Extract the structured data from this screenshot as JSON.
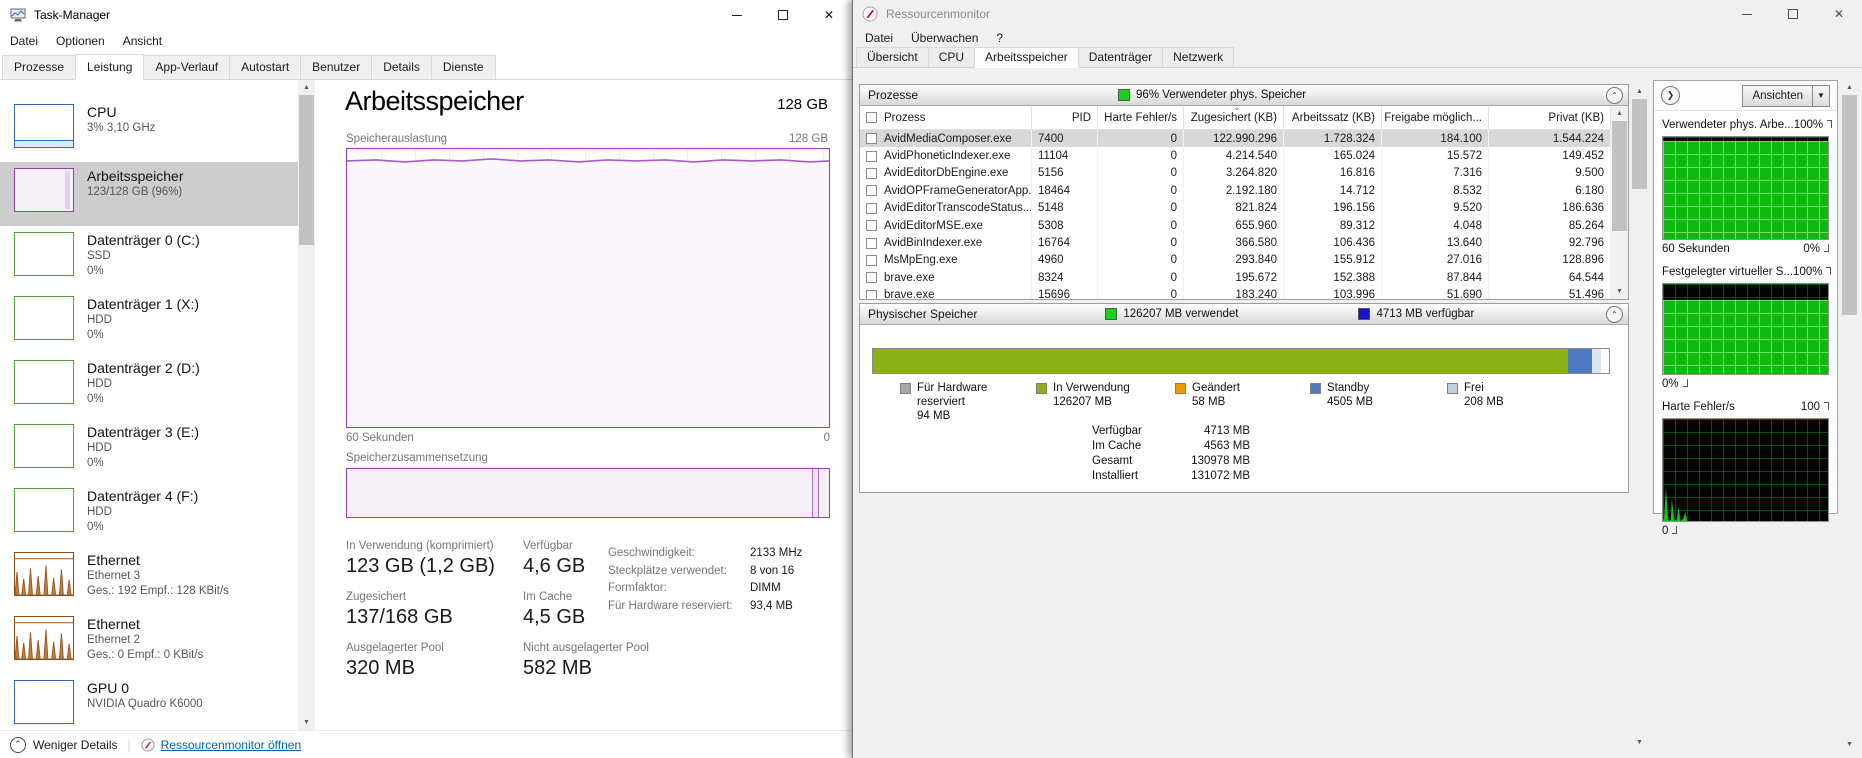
{
  "taskmanager": {
    "title": "Task-Manager",
    "menu": [
      {
        "label": "Datei"
      },
      {
        "label": "Optionen"
      },
      {
        "label": "Ansicht"
      }
    ],
    "tabs": [
      {
        "label": "Prozesse"
      },
      {
        "label": "Leistung",
        "active": true
      },
      {
        "label": "App-Verlauf"
      },
      {
        "label": "Autostart"
      },
      {
        "label": "Benutzer"
      },
      {
        "label": "Details"
      },
      {
        "label": "Dienste"
      }
    ],
    "sidebar": [
      {
        "name": "CPU",
        "line1": "3%  3,10 GHz",
        "type": "cpu"
      },
      {
        "name": "Arbeitsspeicher",
        "line1": "123/128 GB (96%)",
        "type": "memory",
        "selected": true
      },
      {
        "name": "Datenträger 0 (C:)",
        "line1": "SSD",
        "line2": "0%",
        "type": "disk"
      },
      {
        "name": "Datenträger 1 (X:)",
        "line1": "HDD",
        "line2": "0%",
        "type": "disk"
      },
      {
        "name": "Datenträger 2 (D:)",
        "line1": "HDD",
        "line2": "0%",
        "type": "disk"
      },
      {
        "name": "Datenträger 3 (E:)",
        "line1": "HDD",
        "line2": "0%",
        "type": "disk"
      },
      {
        "name": "Datenträger 4 (F:)",
        "line1": "HDD",
        "line2": "0%",
        "type": "disk"
      },
      {
        "name": "Ethernet",
        "line1": "Ethernet 3",
        "line2": "Ges.: 192 Empf.: 128 KBit/s",
        "type": "net"
      },
      {
        "name": "Ethernet",
        "line1": "Ethernet 2",
        "line2": "Ges.: 0 Empf.: 0 KBit/s",
        "type": "net"
      },
      {
        "name": "GPU 0",
        "line1": "NVIDIA Quadro K6000",
        "type": "gpu"
      }
    ],
    "main": {
      "title": "Arbeitsspeicher",
      "capacity": "128 GB",
      "usage_label": "Speicherauslastung",
      "usage_max": "128 GB",
      "time_label": "60 Sekunden",
      "time_right": "0",
      "comp_label": "Speicherzusammensetzung",
      "stats_col1": [
        {
          "label": "In Verwendung (komprimiert)",
          "value": "123 GB (1,2 GB)"
        },
        {
          "label": "Zugesichert",
          "value": "137/168 GB"
        },
        {
          "label": "Ausgelagerter Pool",
          "value": "320 MB"
        }
      ],
      "stats_col2": [
        {
          "label": "Verfügbar",
          "value": "4,6 GB"
        },
        {
          "label": "Im Cache",
          "value": "4,5 GB"
        },
        {
          "label": "Nicht ausgelagerter Pool",
          "value": "582 MB"
        }
      ],
      "details": [
        {
          "label": "Geschwindigkeit:",
          "value": "2133 MHz"
        },
        {
          "label": "Steckplätze verwendet:",
          "value": "8 von 16"
        },
        {
          "label": "Formfaktor:",
          "value": "DIMM"
        },
        {
          "label": "Für Hardware reserviert:",
          "value": "93,4 MB"
        }
      ]
    },
    "footer": {
      "toggle": "Weniger Details",
      "link": "Ressourcenmonitor öffnen"
    }
  },
  "resmon": {
    "title": "Ressourcenmonitor",
    "menu": [
      {
        "label": "Datei"
      },
      {
        "label": "Überwachen"
      },
      {
        "label": "?"
      }
    ],
    "tabs": [
      {
        "label": "Übersicht"
      },
      {
        "label": "CPU"
      },
      {
        "label": "Arbeitsspeicher",
        "active": true
      },
      {
        "label": "Datenträger"
      },
      {
        "label": "Netzwerk"
      }
    ],
    "processes": {
      "title": "Prozesse",
      "status": "96% Verwendeter phys. Speicher",
      "status_color": "#17d417",
      "columns": [
        {
          "label": "Prozess"
        },
        {
          "label": "PID"
        },
        {
          "label": "Harte Fehler/s"
        },
        {
          "label": "Zugesichert (KB)",
          "sort": true
        },
        {
          "label": "Arbeitssatz (KB)"
        },
        {
          "label": "Freigabe möglich..."
        },
        {
          "label": "Privat (KB)"
        }
      ],
      "rows": [
        {
          "name": "AvidMediaComposer.exe",
          "pid": "7400",
          "hf": "0",
          "zug": "122.990.296",
          "arb": "1.728.324",
          "frei": "184.100",
          "priv": "1.544.224",
          "selected": true
        },
        {
          "name": "AvidPhoneticIndexer.exe",
          "pid": "11104",
          "hf": "0",
          "zug": "4.214.540",
          "arb": "165.024",
          "frei": "15.572",
          "priv": "149.452"
        },
        {
          "name": "AvidEditorDbEngine.exe",
          "pid": "5156",
          "hf": "0",
          "zug": "3.264.820",
          "arb": "16.816",
          "frei": "7.316",
          "priv": "9.500"
        },
        {
          "name": "AvidOPFrameGeneratorApp...",
          "pid": "18464",
          "hf": "0",
          "zug": "2.192.180",
          "arb": "14.712",
          "frei": "8.532",
          "priv": "6.180"
        },
        {
          "name": "AvidEditorTranscodeStatus...",
          "pid": "5148",
          "hf": "0",
          "zug": "821.824",
          "arb": "196.156",
          "frei": "9.520",
          "priv": "186.636"
        },
        {
          "name": "AvidEditorMSE.exe",
          "pid": "5308",
          "hf": "0",
          "zug": "655.960",
          "arb": "89.312",
          "frei": "4.048",
          "priv": "85.264"
        },
        {
          "name": "AvidBinIndexer.exe",
          "pid": "16764",
          "hf": "0",
          "zug": "366.580",
          "arb": "106.436",
          "frei": "13.640",
          "priv": "92.796"
        },
        {
          "name": "MsMpEng.exe",
          "pid": "4960",
          "hf": "0",
          "zug": "293.840",
          "arb": "155.912",
          "frei": "27.016",
          "priv": "128.896"
        },
        {
          "name": "brave.exe",
          "pid": "8324",
          "hf": "0",
          "zug": "195.672",
          "arb": "152.388",
          "frei": "87.844",
          "priv": "64.544"
        },
        {
          "name": "brave.exe",
          "pid": "15696",
          "hf": "0",
          "zug": "183.240",
          "arb": "103.996",
          "frei": "51.690",
          "priv": "51.496"
        }
      ]
    },
    "physical": {
      "title": "Physischer Speicher",
      "used": "126207 MB verwendet",
      "used_color": "#17d417",
      "available": "4713 MB verfügbar",
      "available_color": "#1414c8",
      "legend": [
        {
          "label": "Für Hardware reserviert",
          "value": "94 MB",
          "color": "#a8a8a8"
        },
        {
          "label": "In Verwendung",
          "value": "126207 MB",
          "color": "#8bb117"
        },
        {
          "label": "Geändert",
          "value": "58 MB",
          "color": "#f09a02"
        },
        {
          "label": "Standby",
          "value": "4505 MB",
          "color": "#4d7ac2"
        },
        {
          "label": "Frei",
          "value": "208 MB",
          "color": "#bcd1e8"
        }
      ],
      "totals": [
        {
          "label": "Verfügbar",
          "value": "4713 MB"
        },
        {
          "label": "Im Cache",
          "value": "4563 MB"
        },
        {
          "label": "Gesamt",
          "value": "130978 MB"
        },
        {
          "label": "Installiert",
          "value": "131072 MB"
        }
      ]
    },
    "side": {
      "views": "Ansichten",
      "graphs": [
        {
          "title": "Verwendeter phys. Arbe...",
          "max": "100%",
          "footer_left": "60 Sekunden",
          "footer_right": "0%",
          "fill": 96
        },
        {
          "title": "Festgelegter virtueller S...",
          "max": "100%",
          "footer_right": "0%",
          "fill": 82
        },
        {
          "title": "Harte Fehler/s",
          "max": "100",
          "footer_right": "0",
          "fill": 0,
          "spikes": true
        }
      ]
    }
  }
}
